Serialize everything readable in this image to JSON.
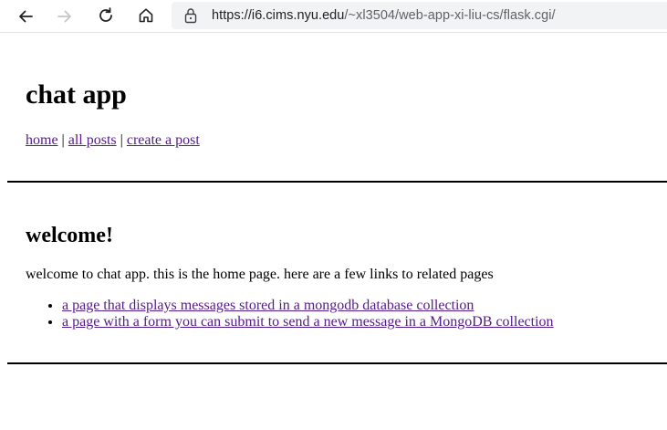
{
  "browser": {
    "url_host": "https://i6.cims.nyu.edu",
    "url_path": "/~xl3504/web-app-xi-liu-cs/flask.cgi/"
  },
  "page": {
    "title": "chat app",
    "nav": {
      "home": "home",
      "separator": "|",
      "all_posts": "all posts",
      "create_post": "create a post"
    },
    "section_title": "welcome!",
    "intro": "welcome to chat app. this is the home page. here are a few links to related pages",
    "links": [
      "a page that displays messages stored in a mongodb database collection",
      "a page with a form you can submit to send a new message in a MongoDB collection"
    ]
  },
  "colors": {
    "link_visited": "#551a8b",
    "toolbar_bg": "#ffffff",
    "address_bar_bg": "#f1f3f4"
  },
  "icons": {
    "back": "arrow-left-icon",
    "forward": "arrow-right-icon",
    "refresh": "refresh-icon",
    "home": "home-icon",
    "lock": "lock-icon"
  }
}
